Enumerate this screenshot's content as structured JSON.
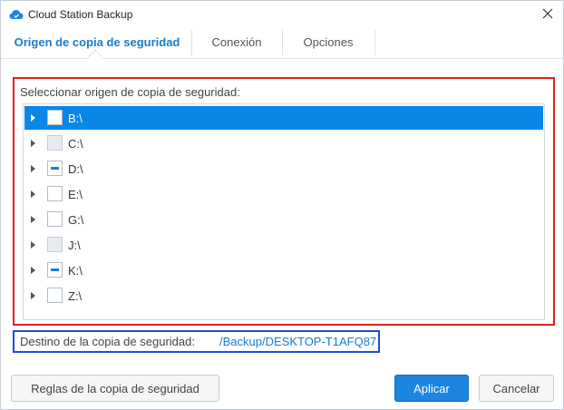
{
  "window": {
    "title": "Cloud Station Backup",
    "accent_color": "#1a7bd3"
  },
  "icons": {
    "app": "cloud-icon",
    "close": "close-icon",
    "expander": "triangle-right-icon"
  },
  "tabs": [
    {
      "label": "Origen de copia de seguridad",
      "active": true
    },
    {
      "label": "Conexión",
      "active": false
    },
    {
      "label": "Opciones",
      "active": false
    }
  ],
  "source": {
    "label": "Seleccionar origen de copia de seguridad:",
    "drives": [
      {
        "label": "B:\\",
        "check_state": "unchecked",
        "selected": true
      },
      {
        "label": "C:\\",
        "check_state": "disabled",
        "selected": false
      },
      {
        "label": "D:\\",
        "check_state": "partial",
        "selected": false
      },
      {
        "label": "E:\\",
        "check_state": "unchecked",
        "selected": false
      },
      {
        "label": "G:\\",
        "check_state": "unchecked",
        "selected": false
      },
      {
        "label": "J:\\",
        "check_state": "disabled",
        "selected": false
      },
      {
        "label": "K:\\",
        "check_state": "partial",
        "selected": false
      },
      {
        "label": "Z:\\",
        "check_state": "unchecked",
        "selected": false
      }
    ]
  },
  "destination": {
    "label": "Destino de la copia de seguridad:",
    "value": "/Backup/DESKTOP-T1AFQ87"
  },
  "buttons": {
    "rules": "Reglas de la copia de seguridad",
    "apply": "Aplicar",
    "cancel": "Cancelar"
  },
  "highlight_colors": {
    "source_box": "#e0211b",
    "destination_box": "#1f4fd1"
  }
}
